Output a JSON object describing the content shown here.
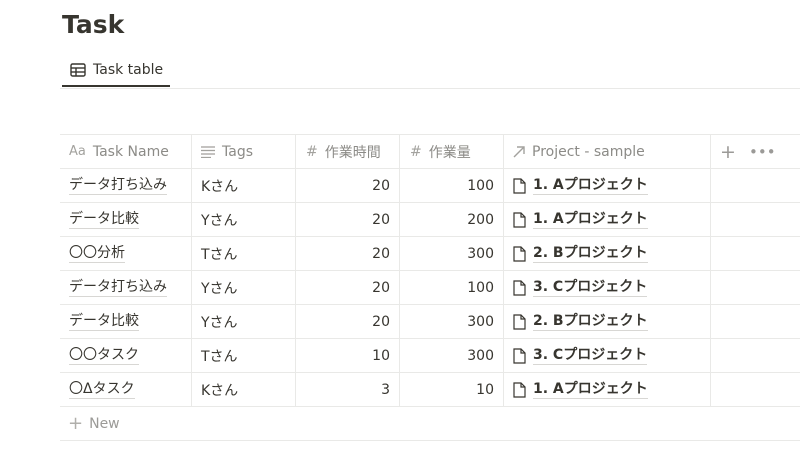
{
  "page": {
    "title": "Task"
  },
  "tabs": [
    {
      "label": "Task table",
      "icon": "table-icon",
      "active": true
    }
  ],
  "table": {
    "columns": [
      {
        "label": "Task Name",
        "icon": "aa-text-icon"
      },
      {
        "label": "Tags",
        "icon": "list-lines-icon"
      },
      {
        "label": "作業時間",
        "icon": "hash-icon"
      },
      {
        "label": "作業量",
        "icon": "hash-icon"
      },
      {
        "label": "Project - sample",
        "icon": "relation-arrow-icon"
      }
    ],
    "rows": [
      {
        "name": "データ打ち込み",
        "tag": "Kさん",
        "hours": "20",
        "amount": "100",
        "project": "1. Aプロジェクト"
      },
      {
        "name": "データ比較",
        "tag": "Yさん",
        "hours": "20",
        "amount": "200",
        "project": "1. Aプロジェクト"
      },
      {
        "name": "〇〇分析",
        "tag": "Tさん",
        "hours": "20",
        "amount": "300",
        "project": "2. Bプロジェクト"
      },
      {
        "name": "データ打ち込み",
        "tag": "Yさん",
        "hours": "20",
        "amount": "100",
        "project": "3. Cプロジェクト"
      },
      {
        "name": "データ比較",
        "tag": "Yさん",
        "hours": "20",
        "amount": "300",
        "project": "2. Bプロジェクト"
      },
      {
        "name": "〇〇タスク",
        "tag": "Tさん",
        "hours": "10",
        "amount": "300",
        "project": "3. Cプロジェクト"
      },
      {
        "name": "〇Δタスク",
        "tag": "Kさん",
        "hours": "3",
        "amount": "10",
        "project": "1. Aプロジェクト"
      }
    ],
    "add_property_icon": "plus-icon",
    "more_icon": "ellipsis-icon",
    "new_label": "New"
  }
}
